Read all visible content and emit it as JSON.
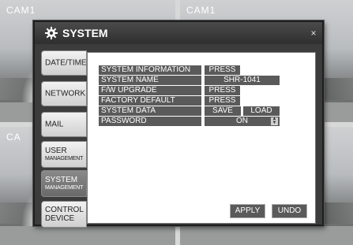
{
  "cameras": [
    {
      "label": "CAM1"
    },
    {
      "label": "CAM1"
    },
    {
      "label": "CA"
    },
    {
      "label": ""
    }
  ],
  "dialog": {
    "title": "SYSTEM",
    "icon": "gear-icon",
    "close_label": "×"
  },
  "sidebar": {
    "items": [
      {
        "label": "DATE/TIME",
        "sub": ""
      },
      {
        "label": "NETWORK",
        "sub": ""
      },
      {
        "label": "MAIL",
        "sub": ""
      },
      {
        "label": "USER",
        "sub": "MANAGEMENT"
      },
      {
        "label": "SYSTEM",
        "sub": "MANAGEMENT"
      },
      {
        "label": "CONTROL",
        "sub": "DEVICE"
      }
    ],
    "active": "SYSTEM"
  },
  "settings": {
    "system_information": {
      "label": "SYSTEM INFORMATION",
      "button": "PRESS"
    },
    "system_name": {
      "label": "SYSTEM NAME",
      "value": "SHR-1041"
    },
    "fw_upgrade": {
      "label": "F/W UPGRADE",
      "button": "PRESS"
    },
    "factory_default": {
      "label": "FACTORY DEFAULT",
      "button": "PRESS"
    },
    "system_data": {
      "label": "SYSTEM DATA",
      "save": "SAVE",
      "load": "LOAD"
    },
    "password": {
      "label": "PASSWORD",
      "value": "ON",
      "spin_up": "▲",
      "spin_down": "▼"
    }
  },
  "footer": {
    "apply": "APPLY",
    "undo": "UNDO"
  }
}
